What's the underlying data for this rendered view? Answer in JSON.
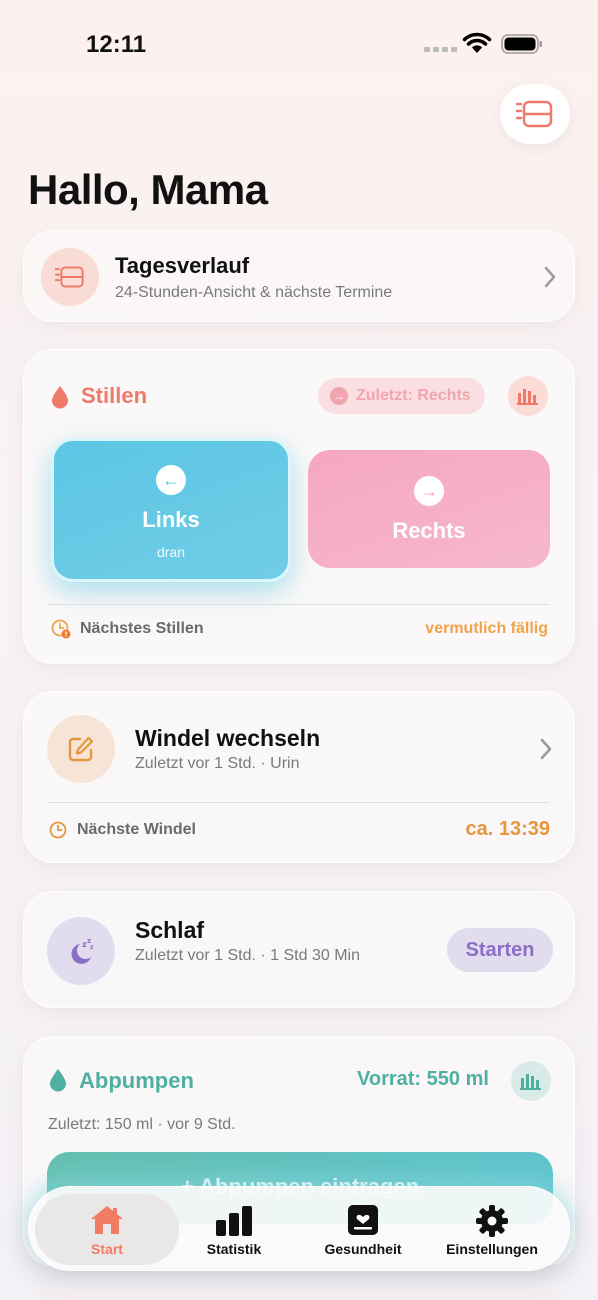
{
  "status_bar": {
    "time": "12:11"
  },
  "greeting": "Hallo, Mama",
  "tagesverlauf": {
    "title": "Tagesverlauf",
    "subtitle": "24-Stunden-Ansicht & nächste Termine"
  },
  "stillen": {
    "title": "Stillen",
    "last_side": "Zuletzt: Rechts",
    "left_label": "Links",
    "left_sub": "dran",
    "right_label": "Rechts",
    "next_label": "Nächstes Stillen",
    "next_value": "vermutlich fällig"
  },
  "windel": {
    "title": "Windel wechseln",
    "subtitle": "Zuletzt vor 1 Std. · Urin",
    "next_label": "Nächste Windel",
    "next_value": "ca. 13:39"
  },
  "schlaf": {
    "title": "Schlaf",
    "subtitle": "Zuletzt vor 1 Std. · 1 Std 30 Min",
    "start_label": "Starten"
  },
  "abpumpen": {
    "title": "Abpumpen",
    "stock": "Vorrat: 550 ml",
    "last": "Zuletzt: 150 ml · vor 9 Std.",
    "add_label": "+ Abpumpen eintragen"
  },
  "tabs": [
    {
      "label": "Start",
      "icon": "home-icon",
      "active": true
    },
    {
      "label": "Statistik",
      "icon": "bar-chart-icon",
      "active": false
    },
    {
      "label": "Gesundheit",
      "icon": "health-record-icon",
      "active": false
    },
    {
      "label": "Einstellungen",
      "icon": "gear-icon",
      "active": false
    }
  ],
  "colors": {
    "stillen_accent": "#f07a6a",
    "left_side": "#5bc6e4",
    "right_side": "#f5a7c0",
    "windel_accent": "#e8963c",
    "schlaf_accent": "#8b6fc6",
    "abpumpen_accent": "#4fb0a2",
    "tab_active": "#f17b63"
  }
}
